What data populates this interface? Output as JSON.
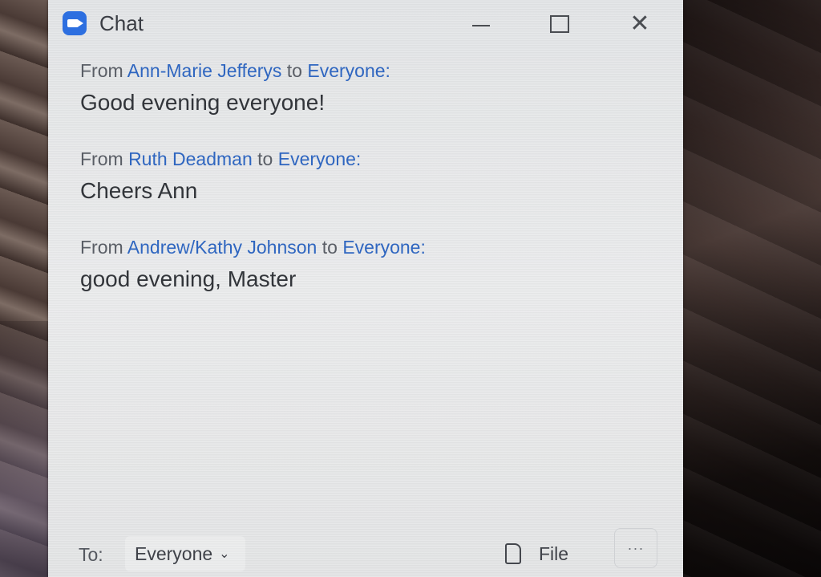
{
  "window": {
    "title": "Chat",
    "app_icon": "video-camera-icon"
  },
  "messages": [
    {
      "from_prefix": "From",
      "sender": "Ann-Marie Jefferys",
      "to_prefix": "to",
      "recipient": "Everyone:",
      "text": "Good evening everyone!"
    },
    {
      "from_prefix": "From",
      "sender": "Ruth Deadman",
      "to_prefix": "to",
      "recipient": "Everyone:",
      "text": "Cheers Ann"
    },
    {
      "from_prefix": "From",
      "sender": "Andrew/Kathy Johnson",
      "to_prefix": "to",
      "recipient": "Everyone:",
      "text": "good evening, Master"
    }
  ],
  "footer": {
    "to_label": "To:",
    "to_value": "Everyone",
    "file_label": "File",
    "more_label": "···"
  },
  "colors": {
    "accent": "#2f66c0",
    "logo": "#2d6fe0"
  }
}
